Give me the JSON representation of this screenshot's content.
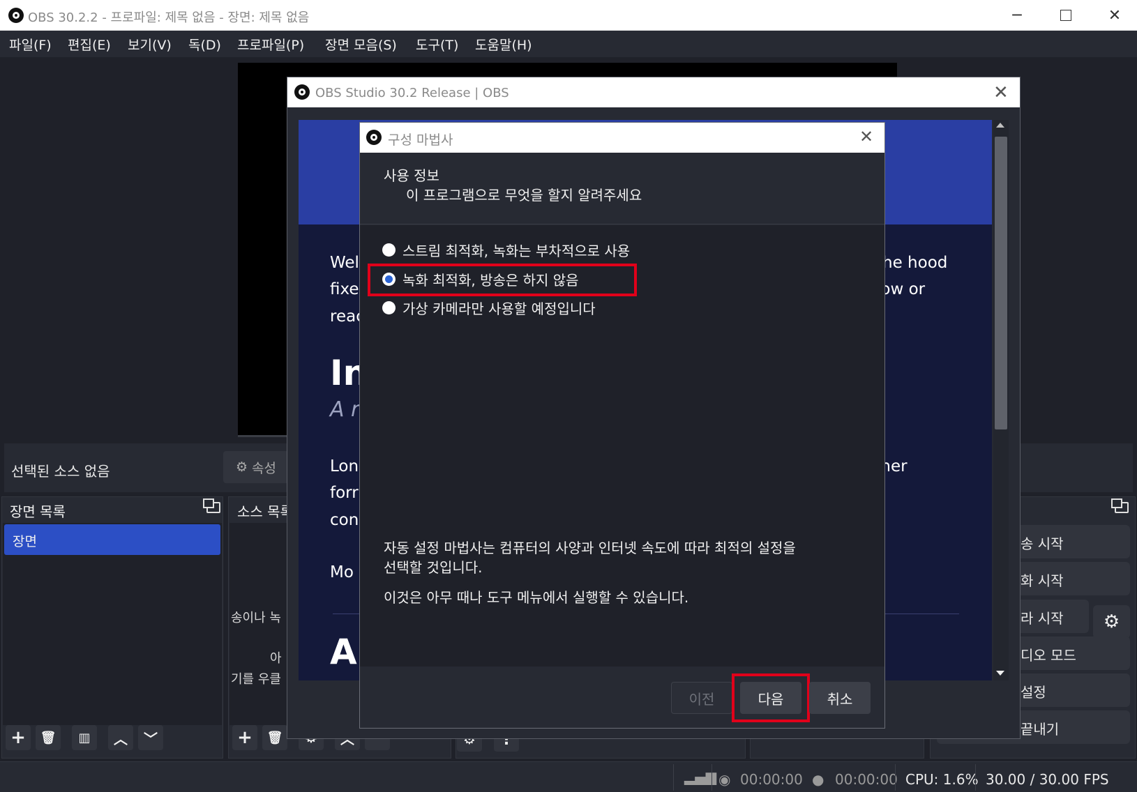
{
  "window": {
    "title": "OBS 30.2.2 - 프로파일: 제목 없음 - 장면: 제목 없음",
    "minimize_glyph": "─",
    "close_glyph": "✕"
  },
  "menu": [
    "파일(F)",
    "편집(E)",
    "보기(V)",
    "독(D)",
    "프로파일(P)",
    "장면 모음(S)",
    "도구(T)",
    "도움말(H)"
  ],
  "context_bar": {
    "no_source": "선택된 소스 없음",
    "properties": "속성"
  },
  "scenes_dock": {
    "title": "장면 목록",
    "items": [
      "장면"
    ]
  },
  "sources_dock": {
    "title": "소스 목록",
    "hint_line1": "송이나 녹",
    "hint_line2": "아",
    "hint_line3": "기를 우클"
  },
  "controls_dock": {
    "buttons": [
      "송 시작",
      "화 시작",
      "라 시작",
      "디오 모드",
      "설정",
      "끝내기"
    ]
  },
  "status_bar": {
    "stream_time": "00:00:00",
    "record_time": "00:00:00",
    "cpu": "CPU: 1.6%",
    "fps": "30.00 / 30.00 FPS"
  },
  "release_notes": {
    "title": "OBS Studio 30.2 Release | OBS",
    "frag_welcome": "Wel",
    "frag_fixe": "fixe",
    "frag_reac": "reac",
    "frag_the_hood": "the hood",
    "frag_low_or": "low or",
    "frag_heading": "In",
    "frag_sub": "A r",
    "frag_lon": "Lon",
    "frag_forr": "forr",
    "frag_con": "con",
    "frag_iner": "iner",
    "frag_e": "e",
    "frag_mo": "Mo",
    "frag_heading2": "A"
  },
  "wizard": {
    "title": "구성 마법사",
    "header_title": "사용 정보",
    "header_subtitle": "이 프로그램으로 무엇을 할지 알려주세요",
    "options": [
      {
        "label": "스트림 최적화, 녹화는 부차적으로 사용",
        "checked": false
      },
      {
        "label": "녹화 최적화, 방송은 하지 않음",
        "checked": true
      },
      {
        "label": "가상 카메라만 사용할 예정입니다",
        "checked": false
      }
    ],
    "info_line1": "자동 설정 마법사는 컴퓨터의 사양과 인터넷 속도에 따라 최적의 설정을",
    "info_line2": "선택할 것입니다.",
    "info_line3": "이것은 아무 때나 도구 메뉴에서 실행할 수 있습니다.",
    "btn_prev": "이전",
    "btn_next": "다음",
    "btn_cancel": "취소"
  },
  "colors": {
    "highlight": "#e0001a",
    "scene_selected": "#2c4fc5",
    "radio_checked": "#2a63d4",
    "dark_bg": "#1f2129",
    "panel_bg": "#272a33",
    "notes_band": "#2a3ea3",
    "notes_bg": "#14193a"
  }
}
